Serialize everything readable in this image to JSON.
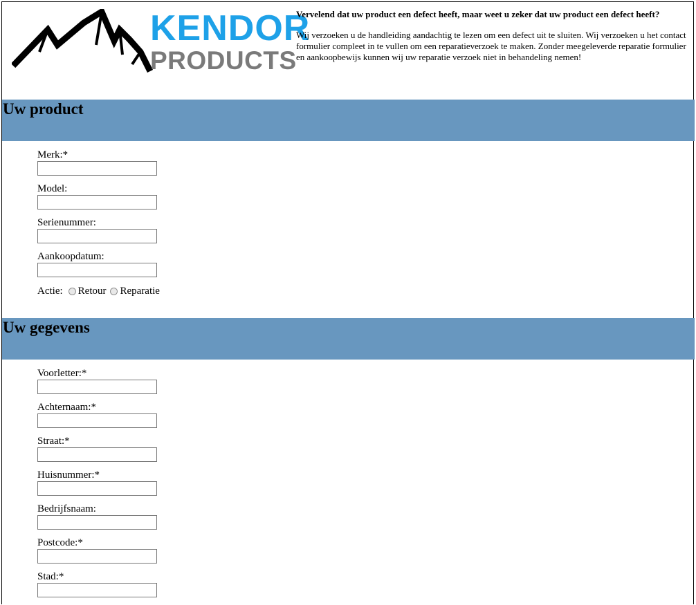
{
  "header": {
    "logo": {
      "brand_line1": "KENDOR",
      "brand_line2": "PRODUCTS",
      "colors": {
        "kendor": "#1ea1e8",
        "products": "#7a7a7a",
        "mountain": "#000000"
      }
    },
    "intro_title": "Vervelend dat uw product een defect heeft, maar weet u zeker dat uw product een defect heeft?",
    "intro_text": "Wij verzoeken u de handleiding aandachtig te lezen om een defect uit te sluiten. Wij verzoeken u het contact formulier compleet in te vullen om een reparatieverzoek te maken. Zonder meegeleverde reparatie formulier en aankoopbewijs kunnen wij uw reparatie verzoek niet in behandeling nemen!"
  },
  "section_color": "#6897bf",
  "product_section": {
    "title": "Uw product",
    "fields": [
      {
        "label": "Merk:*",
        "value": ""
      },
      {
        "label": "Model:",
        "value": ""
      },
      {
        "label": "Serienummer:",
        "value": ""
      },
      {
        "label": "Aankoopdatum:",
        "value": ""
      }
    ],
    "action": {
      "label": "Actie:",
      "options": [
        "Retour",
        "Reparatie"
      ]
    }
  },
  "details_section": {
    "title": "Uw gegevens",
    "fields": [
      {
        "label": "Voorletter:*",
        "value": ""
      },
      {
        "label": "Achternaam:*",
        "value": ""
      },
      {
        "label": "Straat:*",
        "value": ""
      },
      {
        "label": "Huisnummer:*",
        "value": ""
      },
      {
        "label": "Bedrijfsnaam:",
        "value": ""
      },
      {
        "label": "Postcode:*",
        "value": ""
      },
      {
        "label": "Stad:*",
        "value": ""
      }
    ]
  }
}
